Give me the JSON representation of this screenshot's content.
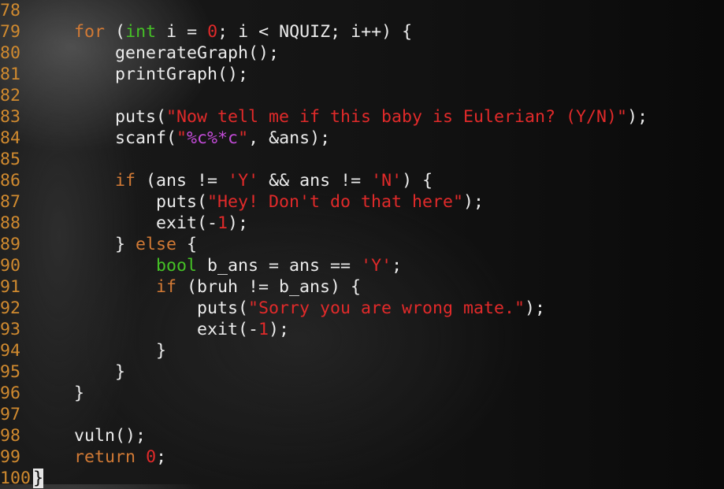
{
  "editor": {
    "lines": [
      {
        "num": "78",
        "tokens": []
      },
      {
        "num": "79",
        "tokens": [
          {
            "t": "    ",
            "c": "p"
          },
          {
            "t": "for",
            "c": "kw"
          },
          {
            "t": " (",
            "c": "p"
          },
          {
            "t": "int",
            "c": "ty"
          },
          {
            "t": " i = ",
            "c": "p"
          },
          {
            "t": "0",
            "c": "num"
          },
          {
            "t": "; i < NQUIZ; i++) {",
            "c": "p"
          }
        ]
      },
      {
        "num": "80",
        "tokens": [
          {
            "t": "        generateGraph();",
            "c": "p"
          }
        ]
      },
      {
        "num": "81",
        "tokens": [
          {
            "t": "        printGraph();",
            "c": "p"
          }
        ]
      },
      {
        "num": "82",
        "tokens": []
      },
      {
        "num": "83",
        "tokens": [
          {
            "t": "        puts(",
            "c": "p"
          },
          {
            "t": "\"Now tell me if this baby is Eulerian? (Y/N)\"",
            "c": "str"
          },
          {
            "t": ");",
            "c": "p"
          }
        ]
      },
      {
        "num": "84",
        "tokens": [
          {
            "t": "        scanf(",
            "c": "p"
          },
          {
            "t": "\"",
            "c": "str"
          },
          {
            "t": "%c%*c",
            "c": "fmt"
          },
          {
            "t": "\"",
            "c": "str"
          },
          {
            "t": ", &ans);",
            "c": "p"
          }
        ]
      },
      {
        "num": "85",
        "tokens": []
      },
      {
        "num": "86",
        "tokens": [
          {
            "t": "        ",
            "c": "p"
          },
          {
            "t": "if",
            "c": "kw"
          },
          {
            "t": " (ans != ",
            "c": "p"
          },
          {
            "t": "'Y'",
            "c": "str"
          },
          {
            "t": " && ans != ",
            "c": "p"
          },
          {
            "t": "'N'",
            "c": "str"
          },
          {
            "t": ") {",
            "c": "p"
          }
        ]
      },
      {
        "num": "87",
        "tokens": [
          {
            "t": "            puts(",
            "c": "p"
          },
          {
            "t": "\"Hey! Don't do that here\"",
            "c": "str"
          },
          {
            "t": ");",
            "c": "p"
          }
        ]
      },
      {
        "num": "88",
        "tokens": [
          {
            "t": "            exit(-",
            "c": "p"
          },
          {
            "t": "1",
            "c": "num"
          },
          {
            "t": ");",
            "c": "p"
          }
        ]
      },
      {
        "num": "89",
        "tokens": [
          {
            "t": "        } ",
            "c": "p"
          },
          {
            "t": "else",
            "c": "kw"
          },
          {
            "t": " {",
            "c": "p"
          }
        ]
      },
      {
        "num": "90",
        "tokens": [
          {
            "t": "            ",
            "c": "p"
          },
          {
            "t": "bool",
            "c": "ty"
          },
          {
            "t": " b_ans = ans == ",
            "c": "p"
          },
          {
            "t": "'Y'",
            "c": "str"
          },
          {
            "t": ";",
            "c": "p"
          }
        ]
      },
      {
        "num": "91",
        "tokens": [
          {
            "t": "            ",
            "c": "p"
          },
          {
            "t": "if",
            "c": "kw"
          },
          {
            "t": " (bruh != b_ans) {",
            "c": "p"
          }
        ]
      },
      {
        "num": "92",
        "tokens": [
          {
            "t": "                puts(",
            "c": "p"
          },
          {
            "t": "\"Sorry you are wrong mate.\"",
            "c": "str"
          },
          {
            "t": ");",
            "c": "p"
          }
        ]
      },
      {
        "num": "93",
        "tokens": [
          {
            "t": "                exit(-",
            "c": "p"
          },
          {
            "t": "1",
            "c": "num"
          },
          {
            "t": ");",
            "c": "p"
          }
        ]
      },
      {
        "num": "94",
        "tokens": [
          {
            "t": "            }",
            "c": "p"
          }
        ]
      },
      {
        "num": "95",
        "tokens": [
          {
            "t": "        }",
            "c": "p"
          }
        ]
      },
      {
        "num": "96",
        "tokens": [
          {
            "t": "    }",
            "c": "p"
          }
        ]
      },
      {
        "num": "97",
        "tokens": []
      },
      {
        "num": "98",
        "tokens": [
          {
            "t": "    vuln();",
            "c": "p"
          }
        ]
      },
      {
        "num": "99",
        "tokens": [
          {
            "t": "    ",
            "c": "p"
          },
          {
            "t": "return",
            "c": "kw"
          },
          {
            "t": " ",
            "c": "p"
          },
          {
            "t": "0",
            "c": "num"
          },
          {
            "t": ";",
            "c": "p"
          }
        ]
      },
      {
        "num": "100",
        "tokens": [
          {
            "t": "}",
            "c": "cursor"
          }
        ]
      }
    ]
  }
}
